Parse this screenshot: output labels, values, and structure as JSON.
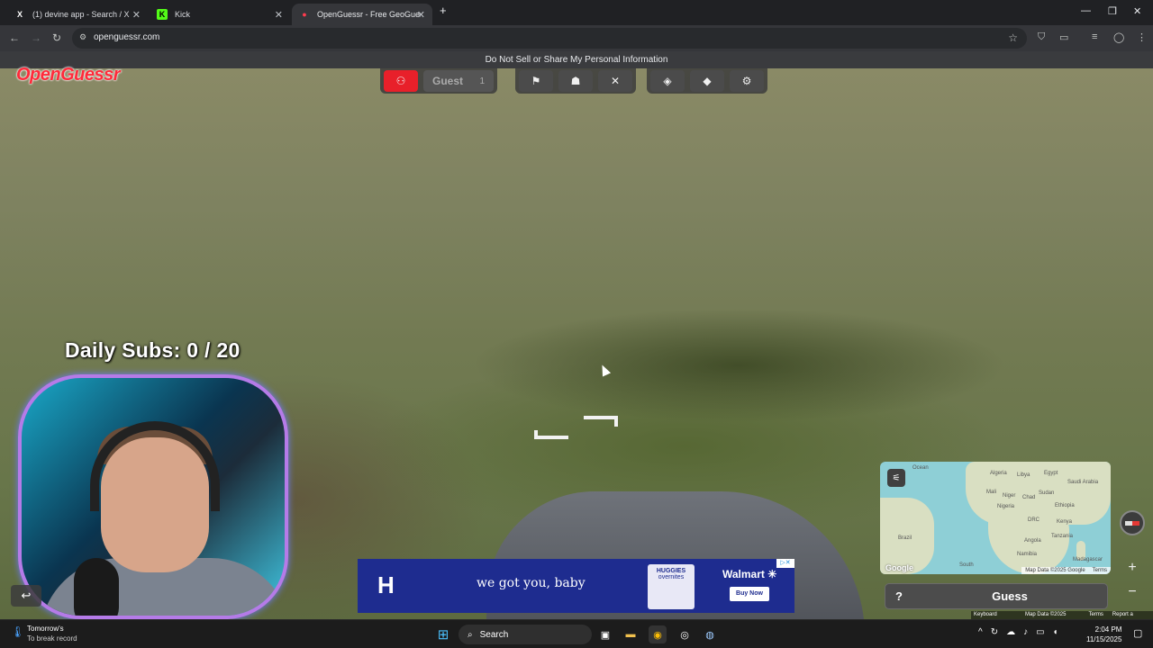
{
  "browser": {
    "tabs": [
      {
        "label": "(1) devine app - Search / X",
        "favicon": "X",
        "active": false
      },
      {
        "label": "Kick",
        "favicon": "K",
        "active": false
      },
      {
        "label": "OpenGuessr - Free GeoGuessr A",
        "favicon": "●",
        "active": true
      }
    ],
    "url": "openguessr.com",
    "new_tab_glyph": "+",
    "close_glyph": "✕"
  },
  "notice": "Do Not Sell or Share My Personal Information",
  "game": {
    "logo": "OpenGuessr",
    "guest_label": "Guest",
    "guest_level": "1",
    "daily_subs": "Daily Subs:  0 / 20"
  },
  "ad": {
    "brand_logo": "H",
    "tagline": "we got you, baby",
    "product": "HUGGIES",
    "product_sub": "overnites",
    "retailer": "Walmart ✳",
    "cta": "Buy Now",
    "ad_mark": "▷✕"
  },
  "map": {
    "labels": [
      "Ocean",
      "Algeria",
      "Libya",
      "Egypt",
      "Saudi Arabia",
      "Mali",
      "Niger",
      "Chad",
      "Sudan",
      "Nigeria",
      "Ethiopia",
      "DRC",
      "Kenya",
      "Tanzania",
      "Angola",
      "Brazil",
      "Namibia",
      "Madagascar",
      "South"
    ],
    "google_logo": "Google",
    "map_data": "Map Data ©2025 Google",
    "terms": "Terms"
  },
  "controls": {
    "help": "?",
    "guess": "Guess",
    "zoom_in": "+",
    "zoom_out": "−",
    "undo": "↩"
  },
  "google_footer": [
    "Keyboard shortcuts",
    "Map Data ©2025 Google",
    "Terms",
    "Report a problem"
  ],
  "taskbar": {
    "weather_title": "Tomorrow's",
    "weather_sub": "To break record",
    "search": "Search",
    "time": "2:04 PM",
    "date": "11/15/2025"
  },
  "colors": {
    "accent_red": "#e8202a",
    "ad_blue": "#1e2c8f",
    "cam_border": "#b57be8"
  }
}
